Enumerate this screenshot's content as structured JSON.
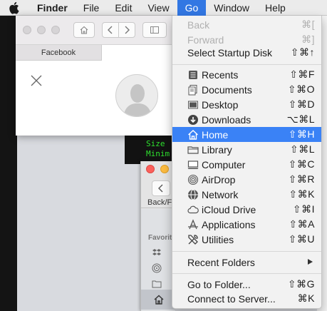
{
  "menubar": {
    "app_name": "Finder",
    "items": [
      {
        "label": "File"
      },
      {
        "label": "Edit"
      },
      {
        "label": "View"
      },
      {
        "label": "Go"
      },
      {
        "label": "Window"
      },
      {
        "label": "Help"
      }
    ],
    "active_item": "Go"
  },
  "browser": {
    "tab_label": "Facebook"
  },
  "terminal": {
    "lines": [
      "Size",
      "Minim"
    ]
  },
  "finder": {
    "back_fwd_label": "Back/F",
    "sidebar_heading": "Favorit"
  },
  "go_menu": {
    "nav": [
      {
        "label": "Back",
        "shortcut": "⌘[",
        "enabled": false
      },
      {
        "label": "Forward",
        "shortcut": "⌘]",
        "enabled": false
      },
      {
        "label": "Select Startup Disk",
        "shortcut": "⇧⌘↑",
        "enabled": true
      }
    ],
    "places": [
      {
        "label": "Recents",
        "shortcut": "⇧⌘F",
        "icon": "recents-icon"
      },
      {
        "label": "Documents",
        "shortcut": "⇧⌘O",
        "icon": "documents-icon"
      },
      {
        "label": "Desktop",
        "shortcut": "⇧⌘D",
        "icon": "desktop-icon"
      },
      {
        "label": "Downloads",
        "shortcut": "⌥⌘L",
        "icon": "downloads-icon"
      },
      {
        "label": "Home",
        "shortcut": "⇧⌘H",
        "icon": "home-icon",
        "highlighted": true
      },
      {
        "label": "Library",
        "shortcut": "⇧⌘L",
        "icon": "library-icon"
      },
      {
        "label": "Computer",
        "shortcut": "⇧⌘C",
        "icon": "computer-icon"
      },
      {
        "label": "AirDrop",
        "shortcut": "⇧⌘R",
        "icon": "airdrop-icon"
      },
      {
        "label": "Network",
        "shortcut": "⇧⌘K",
        "icon": "network-icon"
      },
      {
        "label": "iCloud Drive",
        "shortcut": "⇧⌘I",
        "icon": "icloud-icon"
      },
      {
        "label": "Applications",
        "shortcut": "⇧⌘A",
        "icon": "applications-icon"
      },
      {
        "label": "Utilities",
        "shortcut": "⇧⌘U",
        "icon": "utilities-icon"
      }
    ],
    "recent_folders": {
      "label": "Recent Folders"
    },
    "goto": [
      {
        "label": "Go to Folder...",
        "shortcut": "⇧⌘G"
      },
      {
        "label": "Connect to Server...",
        "shortcut": "⌘K"
      }
    ]
  },
  "colors": {
    "highlight": "#3a82f6",
    "menubar_active": "#3277e3",
    "terminal_text": "#2ee12e"
  }
}
